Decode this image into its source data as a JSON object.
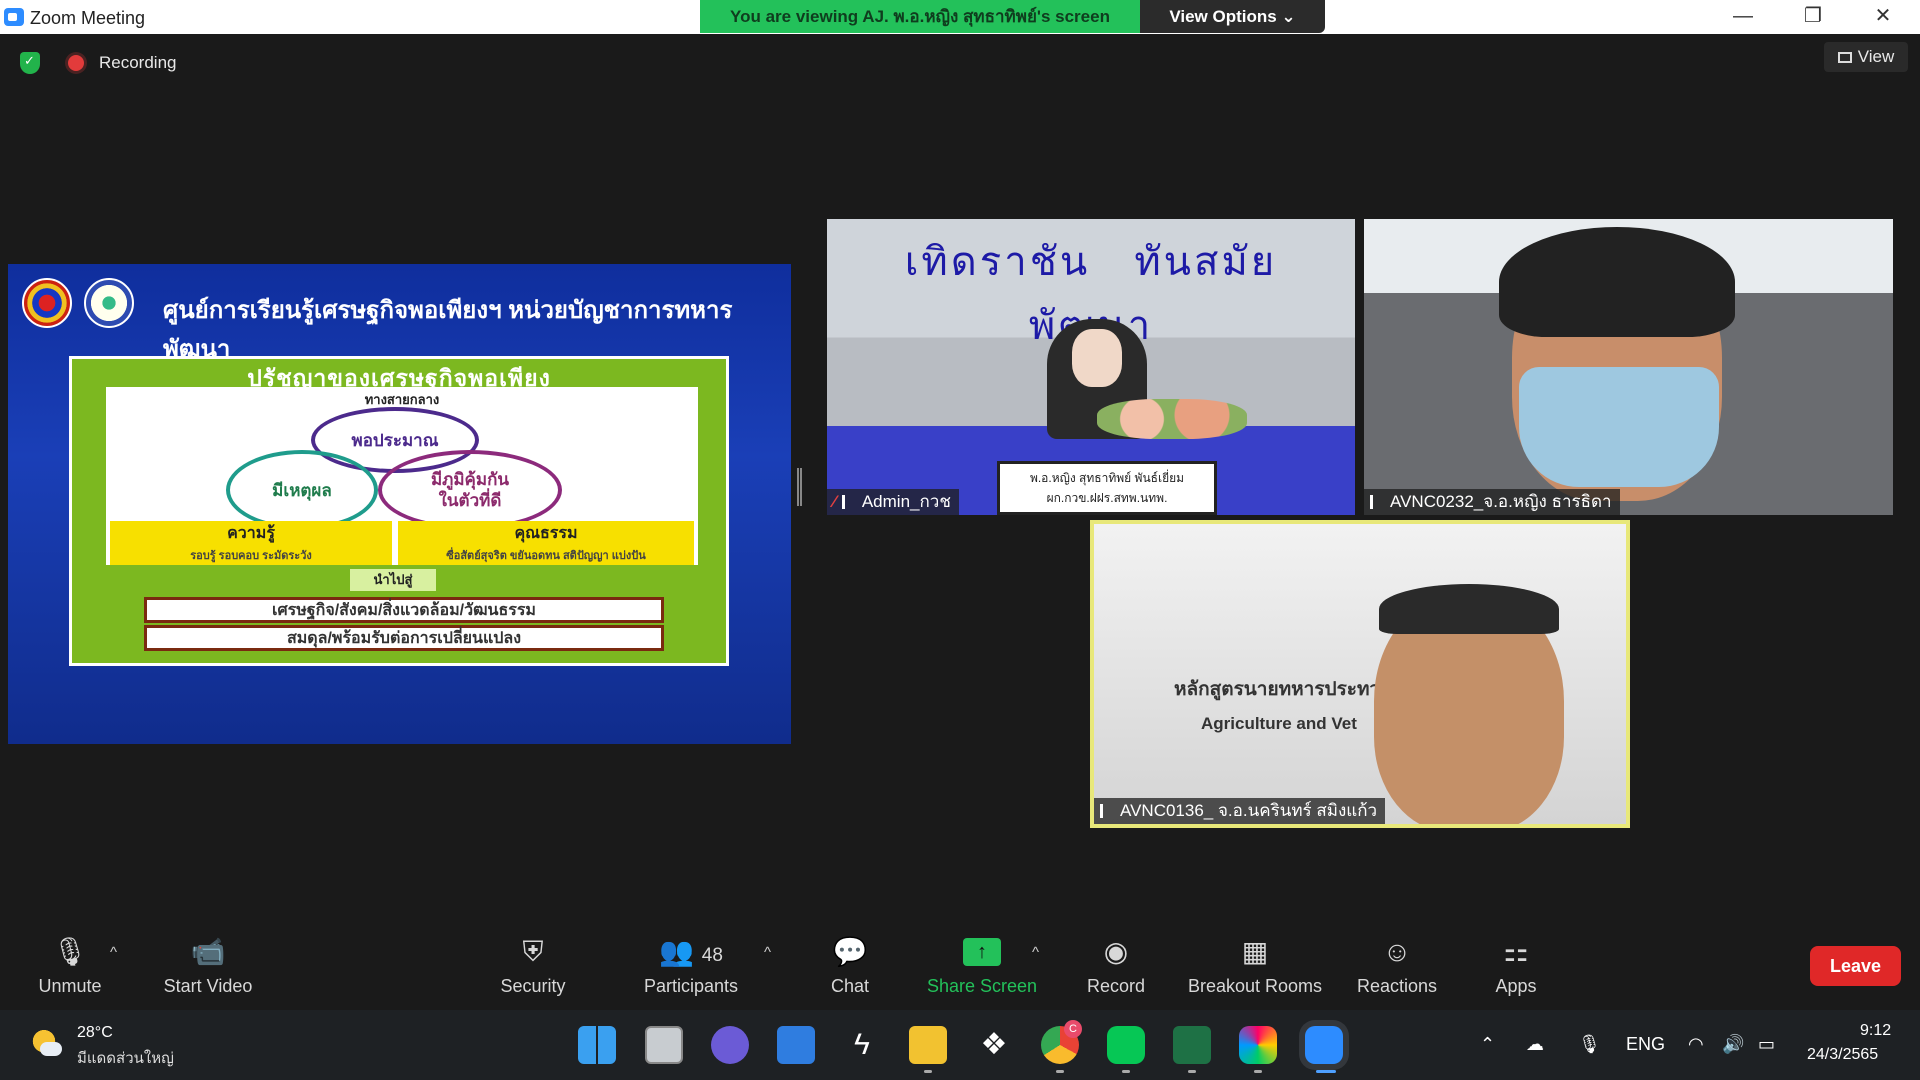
{
  "window": {
    "title": "Zoom Meeting",
    "viewing_banner": "You are viewing AJ. พ.อ.หญิง สุทธาทิพย์'s screen",
    "view_options": "View Options ⌄",
    "minimize": "—",
    "restore": "❐",
    "close": "✕"
  },
  "status": {
    "recording_label": "Recording",
    "view_label": "View"
  },
  "shared_screen": {
    "header_title": "ศูนย์การเรียนรู้เศรษฐกิจพอเพียงฯ หน่วยบัญชาการทหารพัฒนา",
    "slide_title": "ปรัชญาของเศรษฐกิจพอเพียง",
    "middle_path": "ทางสายกลาง",
    "circle_moderation": "พอประมาณ",
    "circle_reason": "มีเหตุผล",
    "circle_immunity_line1": "มีภูมิคุ้มกัน",
    "circle_immunity_line2": "ในตัวที่ดี",
    "knowledge_title": "ความรู้",
    "knowledge_sub": "รอบรู้ รอบคอบ ระมัดระวัง",
    "virtue_title": "คุณธรรม",
    "virtue_sub": "ซื่อสัตย์สุจริต ขยันอดทน สติปัญญา แบ่งปัน",
    "leads_to": "นำไปสู่",
    "outcome1": "เศรษฐกิจ/สังคม/สิ่งแวดล้อม/วัฒนธรรม",
    "outcome2": "สมดุล/พร้อมรับต่อการเปลี่ยนแปลง"
  },
  "participants_video": [
    {
      "name": "Admin_กวช",
      "muted": true,
      "wall_text": "เทิดราชัน ทันสมัย พัฒนา",
      "nameplate_line1": "พ.อ.หญิง สุทธาทิพย์ พันธ์เยี่ยม",
      "nameplate_line2": "ผก.กวข.ฝฝร.สทพ.นทพ."
    },
    {
      "name": "AVNC0232_จ.อ.หญิง ธารธิดา"
    },
    {
      "name": "AVNC0136_ จ.อ.นครินทร์ สมิงแก้ว",
      "bg_title_th": "หลักสูตรนายทหารประทวน",
      "bg_title_en": "Agriculture and Vet"
    }
  ],
  "toolbar": {
    "unmute": "Unmute",
    "start_video": "Start Video",
    "security": "Security",
    "participants": "Participants",
    "participants_count": "48",
    "chat": "Chat",
    "share_screen": "Share Screen",
    "record": "Record",
    "breakout_rooms": "Breakout Rooms",
    "reactions": "Reactions",
    "apps": "Apps",
    "leave": "Leave",
    "caret": "^"
  },
  "taskbar": {
    "temperature": "28°C",
    "weather": "มีแดดส่วนใหญ่",
    "language": "ENG",
    "time": "9:12",
    "date": "24/3/2565",
    "chrome_badge": "C"
  },
  "colors": {
    "zoom_blue": "#2d8cff",
    "banner_green": "#23c15a",
    "leave_red": "#e02828",
    "active_speaker": "#e8e87a"
  }
}
